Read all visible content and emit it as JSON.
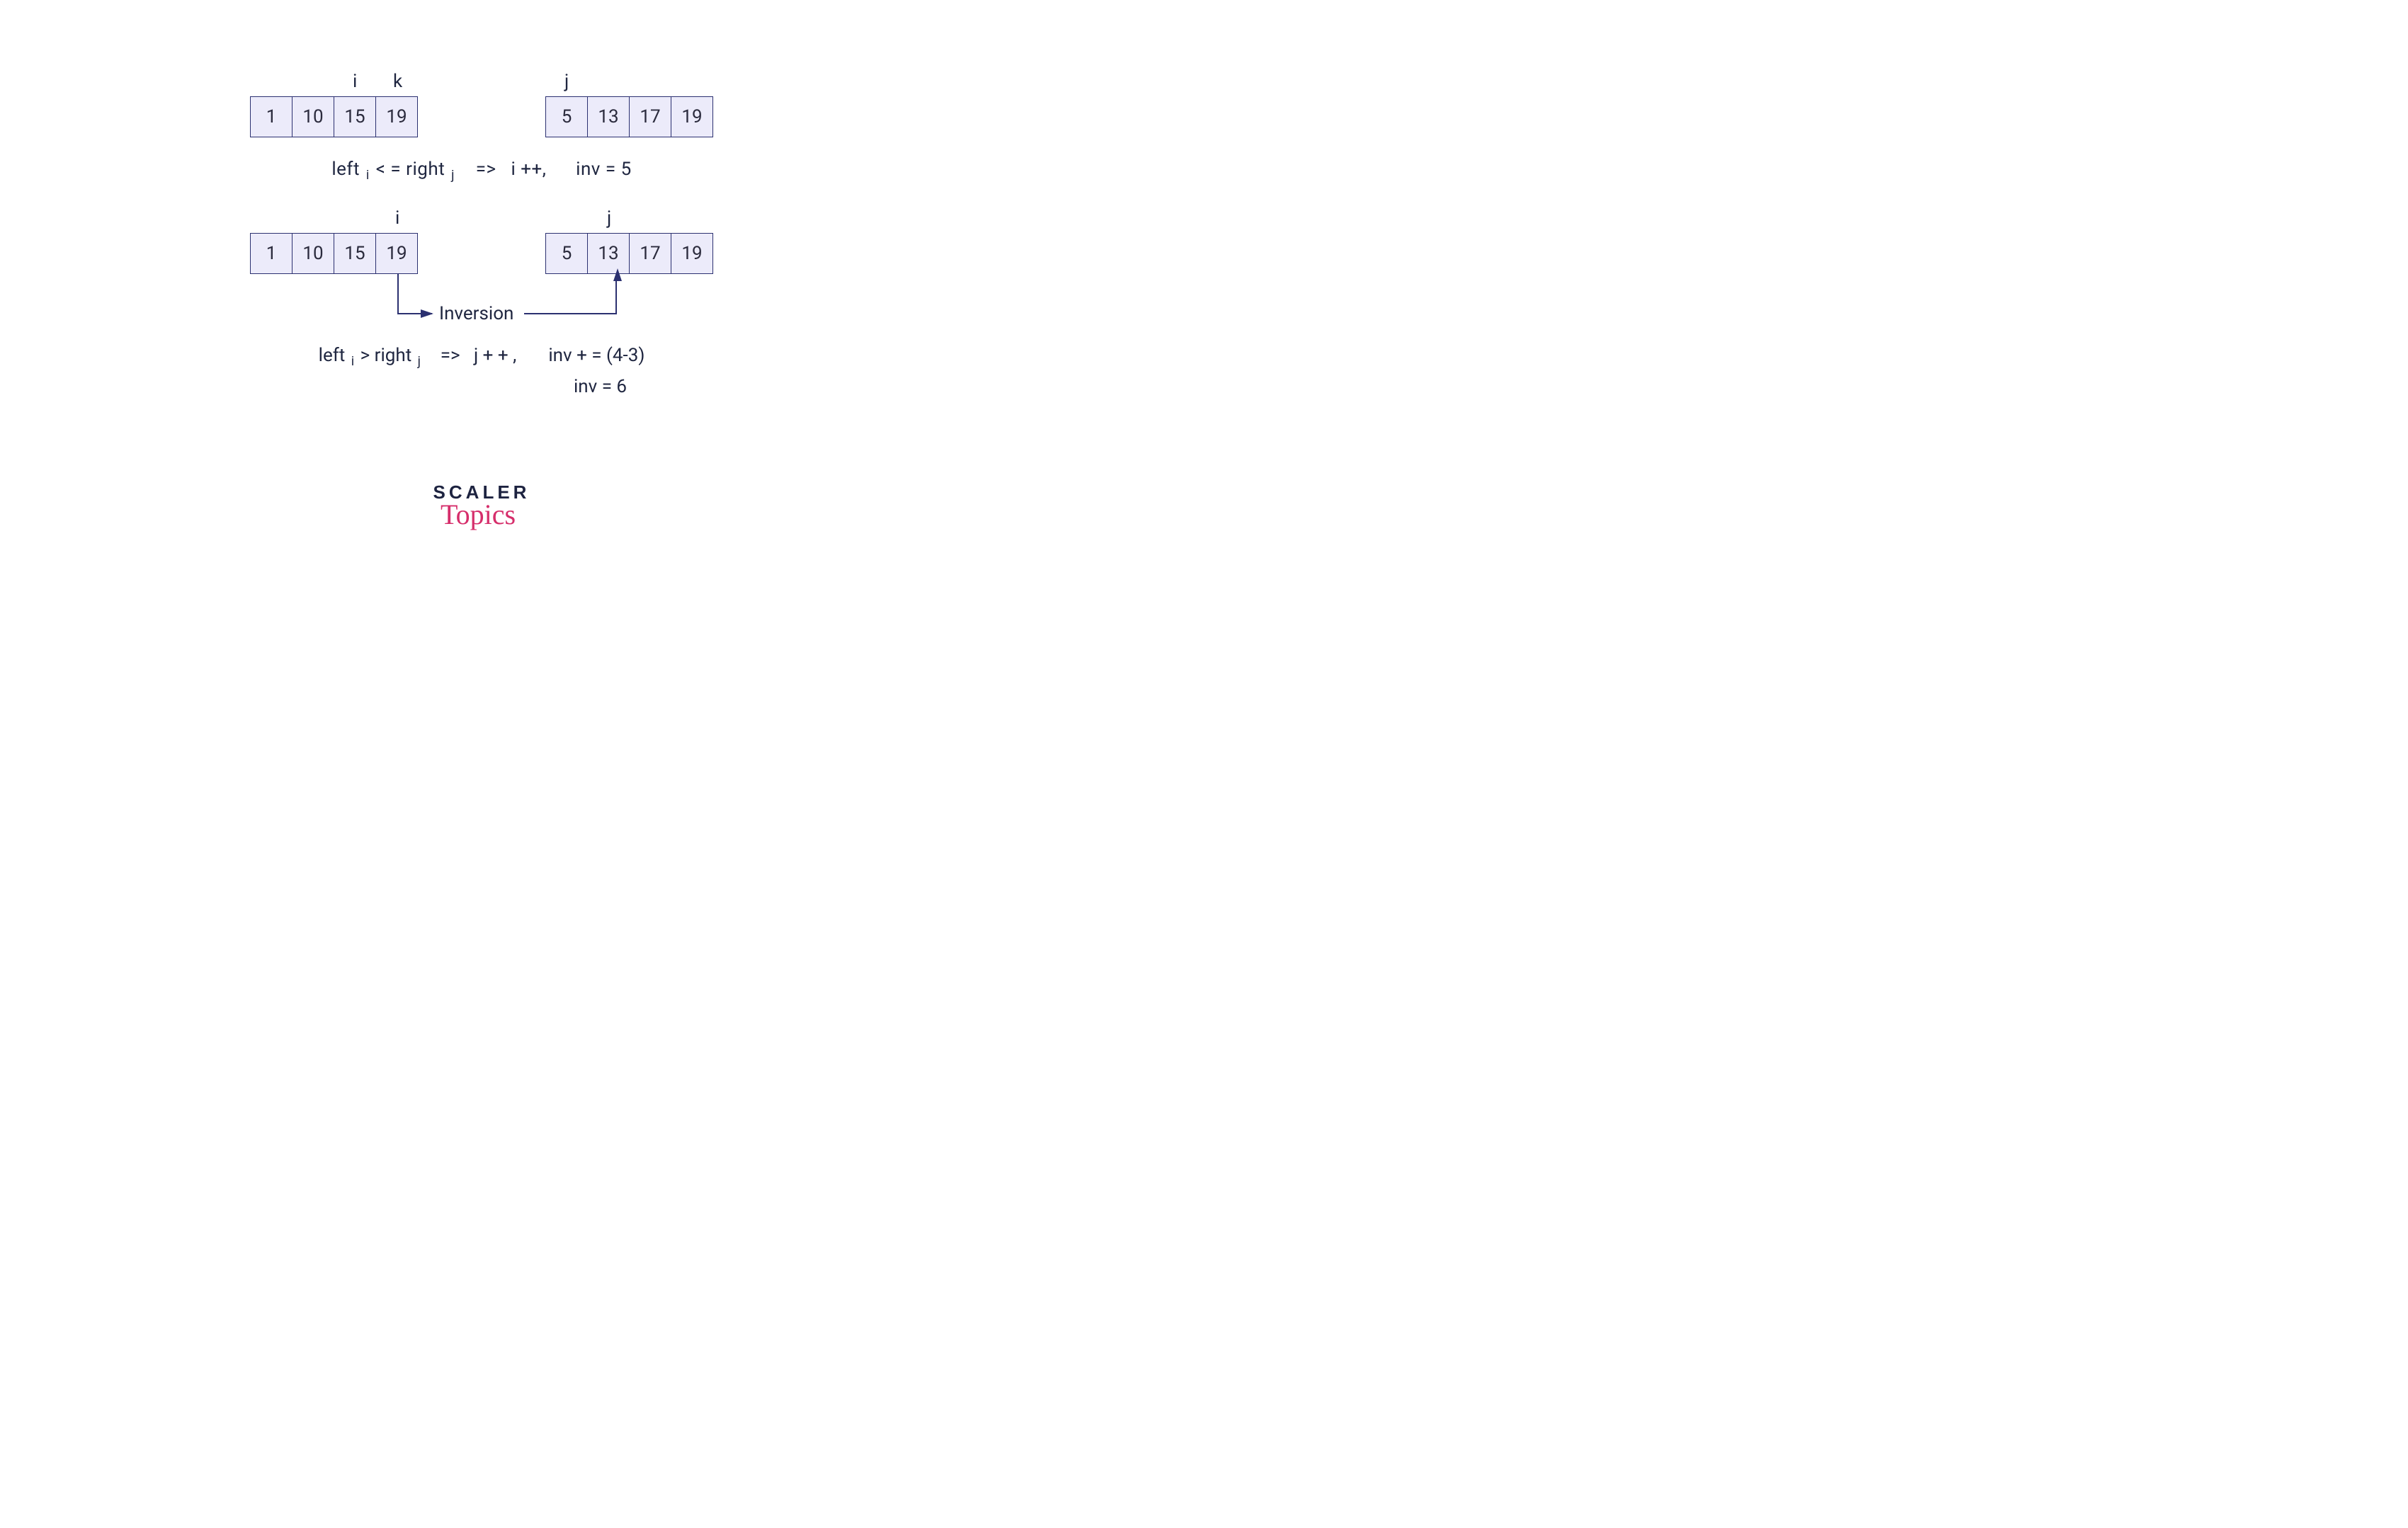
{
  "row1": {
    "left_array": [
      "1",
      "10",
      "15",
      "19"
    ],
    "right_array": [
      "5",
      "13",
      "17",
      "19"
    ],
    "left_pointers": {
      "i_idx": 2,
      "k_idx": 3,
      "i_label": "i",
      "k_label": "k"
    },
    "right_pointers": {
      "j_idx": 0,
      "j_label": "j"
    },
    "caption_left": "left",
    "caption_sub1": "i",
    "caption_op": "< =",
    "caption_right": "right",
    "caption_sub2": "j",
    "caption_arrow": "=>",
    "caption_action": "i ++,",
    "caption_inv": "inv = 5"
  },
  "row2": {
    "left_array": [
      "1",
      "10",
      "15",
      "19"
    ],
    "right_array": [
      "5",
      "13",
      "17",
      "19"
    ],
    "left_pointers": {
      "i_idx": 3,
      "i_label": "i"
    },
    "right_pointers": {
      "j_idx": 1,
      "j_label": "j"
    },
    "inversion_label": "Inversion",
    "caption_left": "left",
    "caption_sub1": "i",
    "caption_op": ">",
    "caption_right": "right",
    "caption_sub2": "j",
    "caption_arrow": "=>",
    "caption_action": "j + + ,",
    "caption_inv1": "inv + = (4-3)",
    "caption_inv2": "inv = 6"
  },
  "logo": {
    "brand": "SCALER",
    "sub": "Topics"
  },
  "colors": {
    "cell_bg": "#ecebfa",
    "border": "#2b3070",
    "text": "#1f2640",
    "accent": "#d62e6b"
  }
}
